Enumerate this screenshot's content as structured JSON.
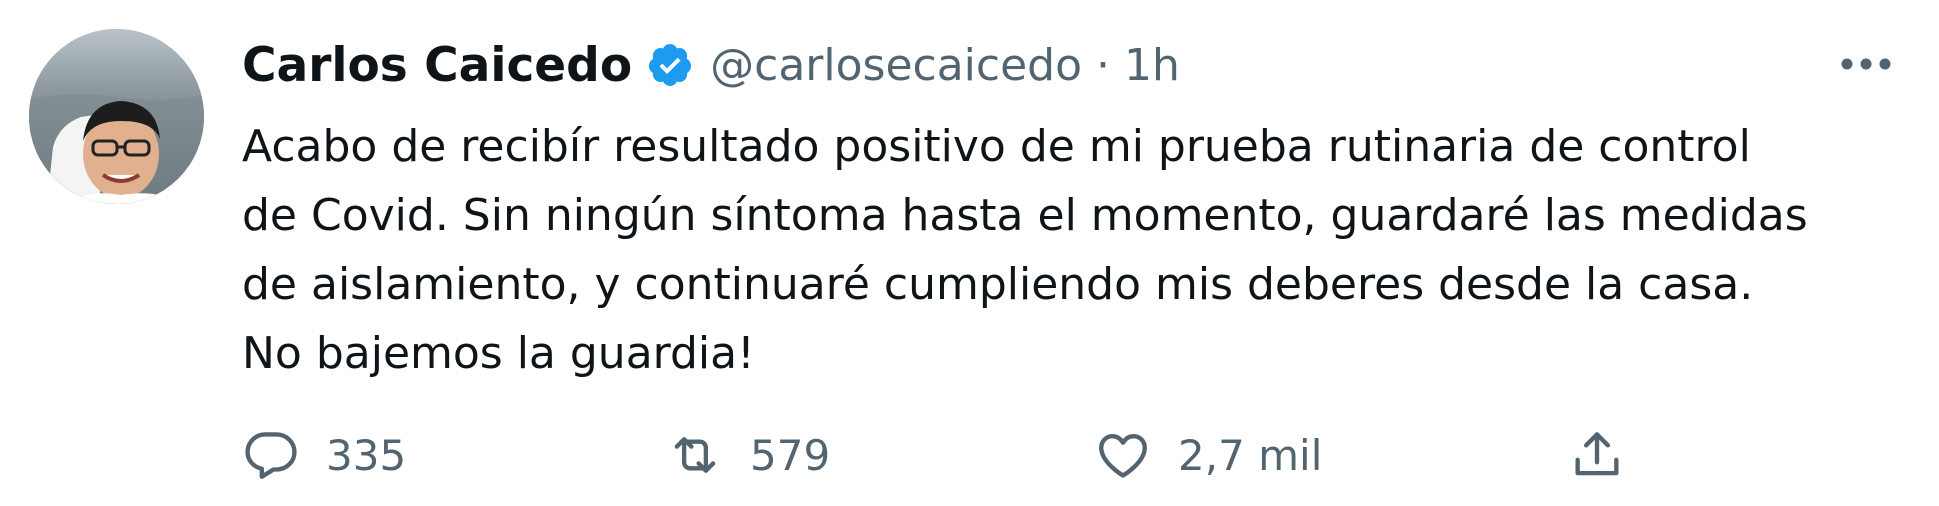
{
  "tweet": {
    "author": {
      "name": "Carlos Caicedo",
      "handle": "@carlosecaicedo",
      "verified": true
    },
    "separator": "·",
    "time": "1h",
    "text_lines": [
      "Acabo de recibír resultado positivo de mi prueba rutinaria de control",
      "de Covid. Sin ningún síntoma hasta el momento, guardaré las medidas",
      "de aislamiento, y continuaré cumpliendo mis deberes desde la casa.",
      "No bajemos la guardia!"
    ],
    "actions": {
      "reply_count": "335",
      "retweet_count": "579",
      "like_count": "2,7 mil"
    }
  },
  "icons": {
    "verified": "verified-badge-icon",
    "more": "more-options-icon",
    "reply": "reply-icon",
    "retweet": "retweet-icon",
    "like": "like-icon",
    "share": "share-icon"
  },
  "colors": {
    "text_primary": "#0f1419",
    "text_secondary": "#536471",
    "verified_blue": "#1d9bf0"
  }
}
